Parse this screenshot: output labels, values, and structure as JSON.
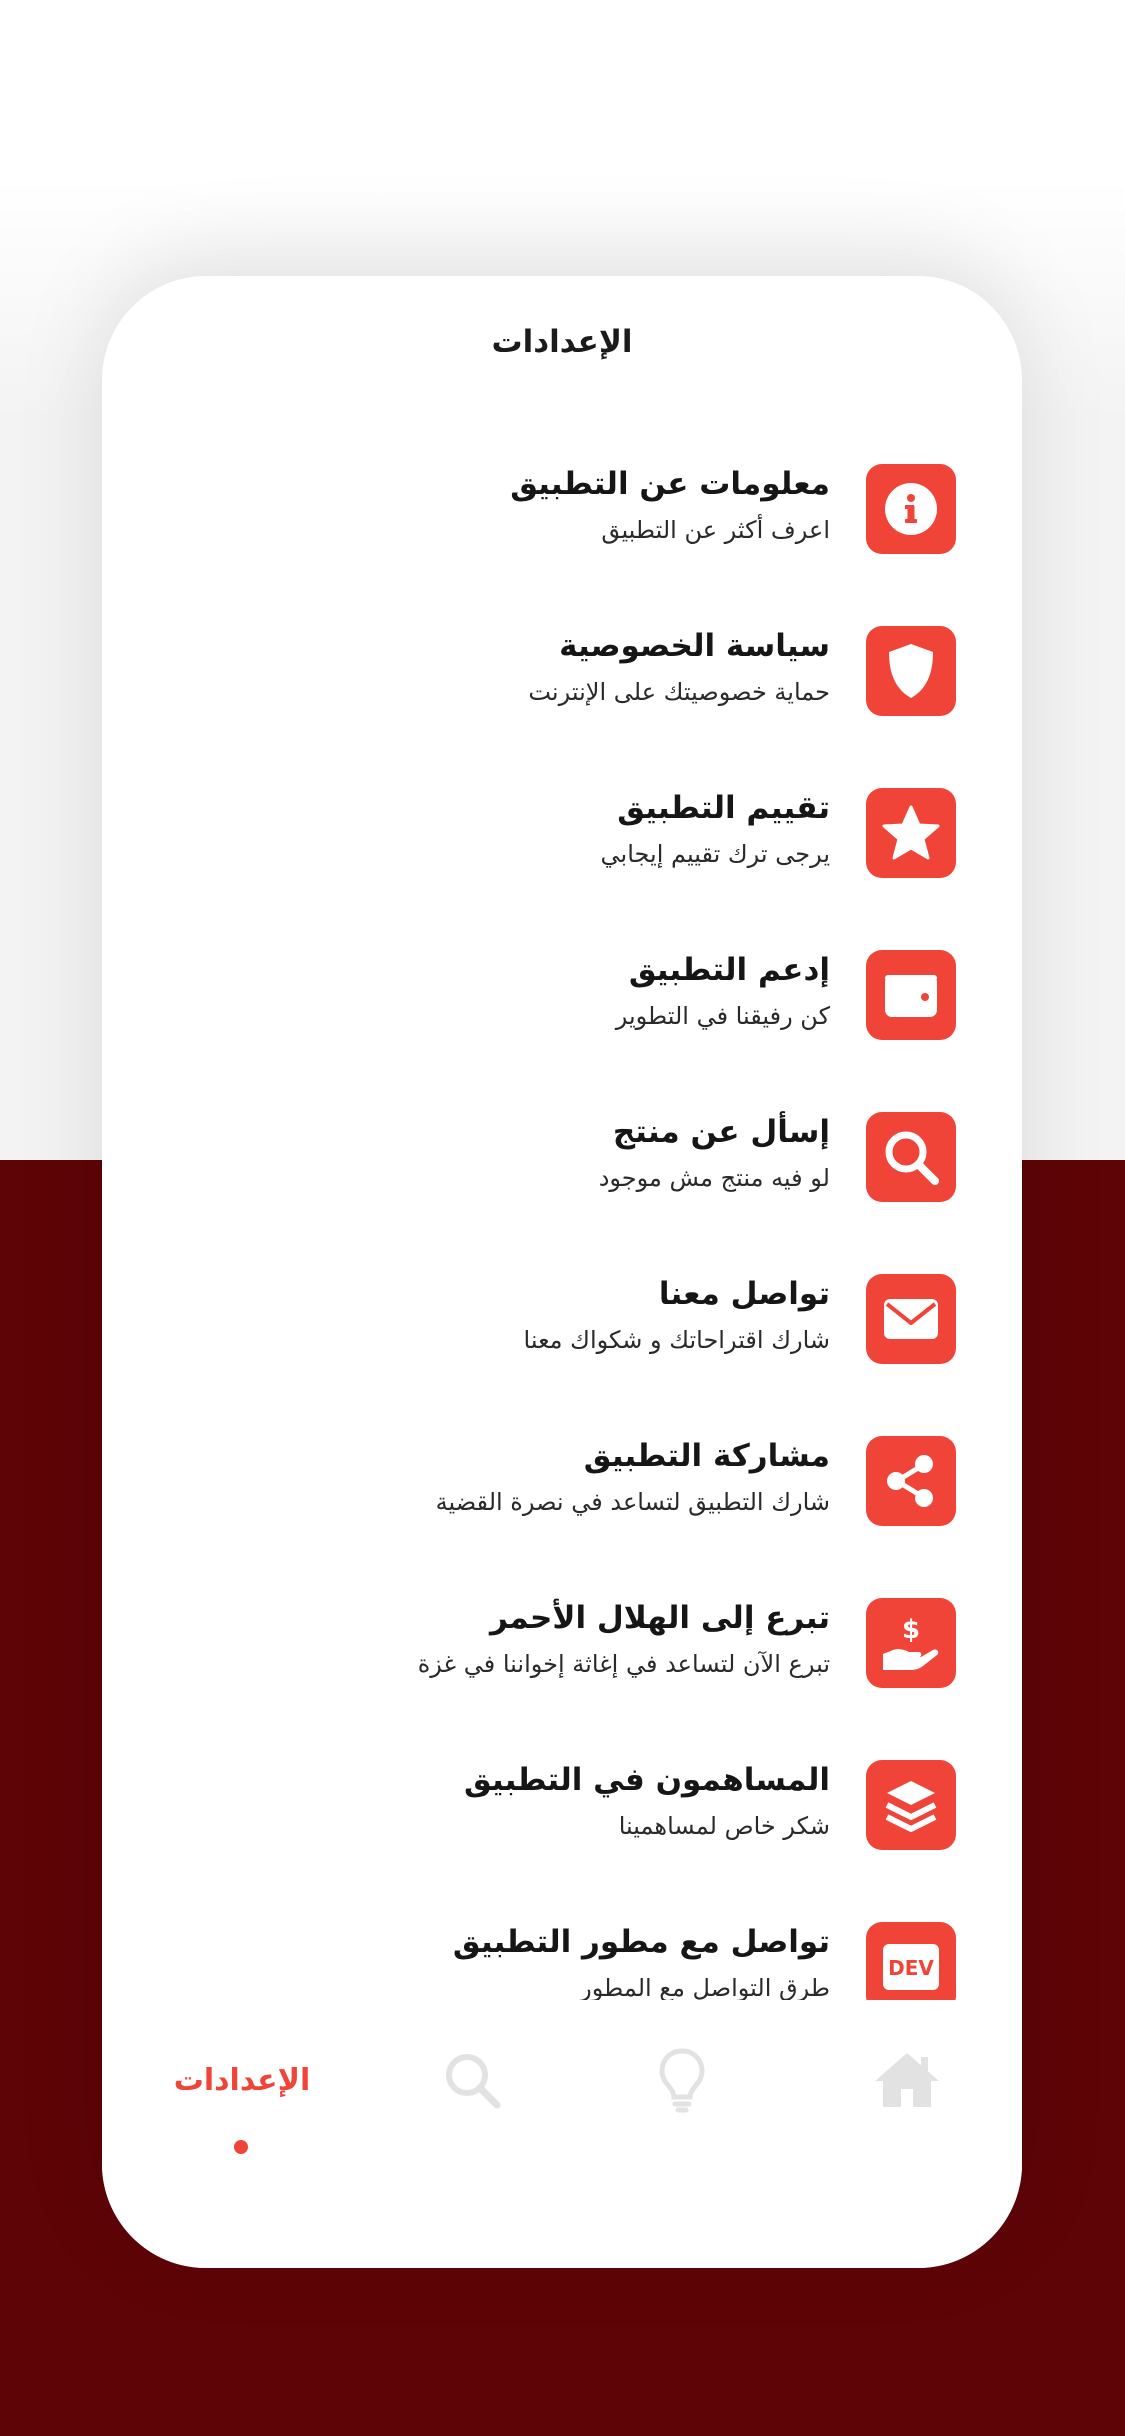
{
  "screen": {
    "title": "الإعدادات"
  },
  "colors": {
    "accent": "#f04438",
    "dark_background": "#5e0407",
    "light_background": "#f3f3f4",
    "inactive_icon": "#e2e2e2"
  },
  "settings": {
    "items": [
      {
        "icon": "info-icon",
        "title": "معلومات عن التطبيق",
        "subtitle": "اعرف أكثر عن التطبيق"
      },
      {
        "icon": "shield-icon",
        "title": "سياسة الخصوصية",
        "subtitle": "حماية خصوصيتك على الإنترنت"
      },
      {
        "icon": "star-icon",
        "title": "تقييم التطبيق",
        "subtitle": "يرجى ترك تقييم إيجابي"
      },
      {
        "icon": "wallet-icon",
        "title": "إدعم التطبيق",
        "subtitle": "كن رفيقنا في التطوير"
      },
      {
        "icon": "search-icon",
        "title": "إسأل عن منتج",
        "subtitle": "لو فيه منتج مش موجود"
      },
      {
        "icon": "envelope-icon",
        "title": "تواصل معنا",
        "subtitle": "شارك اقتراحاتك و شكواك معنا"
      },
      {
        "icon": "share-icon",
        "title": "مشاركة التطبيق",
        "subtitle": "شارك التطبيق لتساعد في نصرة القضية"
      },
      {
        "icon": "donate-hand-icon",
        "title": "تبرع إلى الهلال الأحمر",
        "subtitle": "تبرع الآن لتساعد في إغاثة إخواننا في غزة"
      },
      {
        "icon": "layers-icon",
        "title": "المساهمون في التطبيق",
        "subtitle": "شكر خاص لمساهمينا"
      },
      {
        "icon": "dev-badge-icon",
        "icon_text": "DEV",
        "title": "تواصل مع مطور التطبيق",
        "subtitle": "طرق التواصل مع المطور"
      }
    ]
  },
  "tabbar": {
    "active_label": "الإعدادات",
    "tabs": [
      "settings",
      "search",
      "lightbulb",
      "home"
    ]
  }
}
